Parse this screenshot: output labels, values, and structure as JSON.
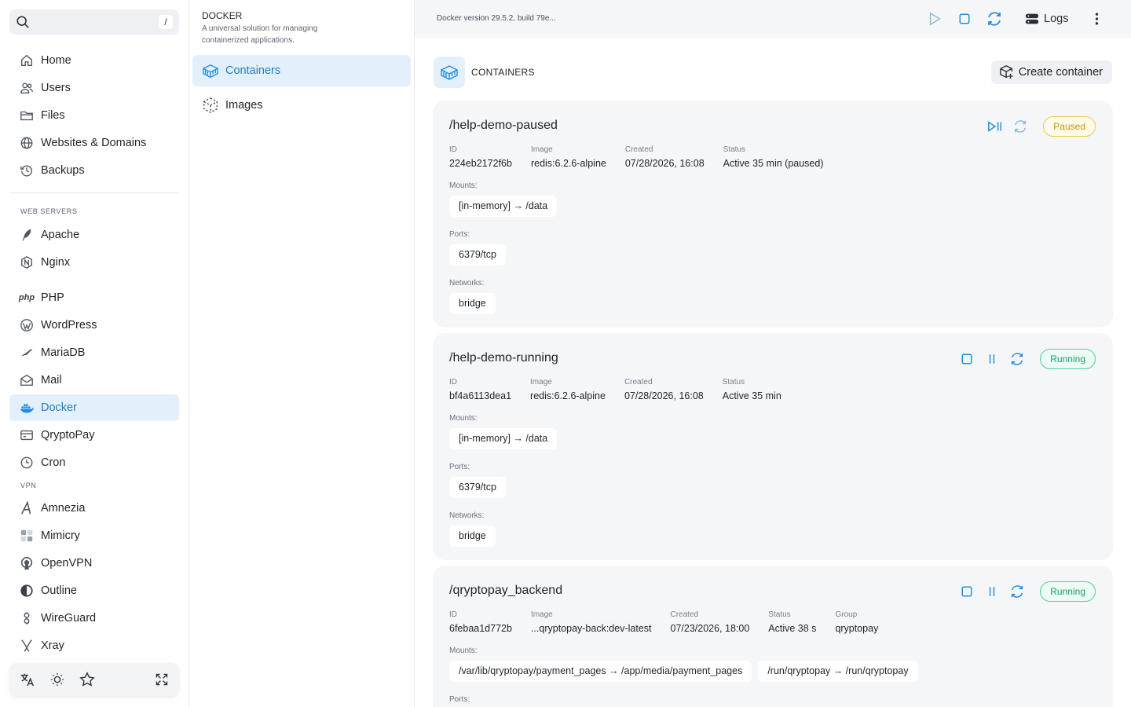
{
  "sidebar": {
    "search_shortcut": "/",
    "items": [
      {
        "label": "Home",
        "icon": "home-icon"
      },
      {
        "label": "Users",
        "icon": "users-icon"
      },
      {
        "label": "Files",
        "icon": "folder-icon"
      },
      {
        "label": "Websites & Domains",
        "icon": "globe-icon"
      },
      {
        "label": "Backups",
        "icon": "history-icon"
      }
    ],
    "section_web_servers": "WEB SERVERS",
    "web_servers": [
      {
        "label": "Apache",
        "icon": "feather-icon"
      },
      {
        "label": "Nginx",
        "icon": "nginx-icon"
      },
      {
        "label": "PHP",
        "icon": "php-icon"
      },
      {
        "label": "WordPress",
        "icon": "wordpress-icon"
      },
      {
        "label": "MariaDB",
        "icon": "mariadb-icon"
      },
      {
        "label": "Mail",
        "icon": "mail-icon"
      },
      {
        "label": "Docker",
        "icon": "docker-icon"
      },
      {
        "label": "QryptoPay",
        "icon": "card-icon"
      },
      {
        "label": "Cron",
        "icon": "clock-icon"
      }
    ],
    "php_glyph": "php",
    "section_vpn": "VPN",
    "vpn": [
      {
        "label": "Amnezia",
        "icon": "amnezia-icon"
      },
      {
        "label": "Mimicry",
        "icon": "mimicry-icon"
      },
      {
        "label": "OpenVPN",
        "icon": "openvpn-icon"
      },
      {
        "label": "Outline",
        "icon": "outline-icon"
      },
      {
        "label": "WireGuard",
        "icon": "wireguard-icon"
      },
      {
        "label": "Xray",
        "icon": "xray-icon"
      }
    ]
  },
  "midpanel": {
    "title": "DOCKER",
    "description": "A universal solution for managing containerized applications.",
    "items": [
      {
        "label": "Containers"
      },
      {
        "label": "Images"
      }
    ]
  },
  "topbar": {
    "version": "Docker version 29.5.2, build 79e...",
    "logs_label": "Logs"
  },
  "section": {
    "title": "CONTAINERS",
    "create_label": "Create container"
  },
  "labels": {
    "id": "ID",
    "image": "Image",
    "created": "Created",
    "status": "Status",
    "group": "Group",
    "mounts": "Mounts:",
    "ports": "Ports:",
    "networks": "Networks:"
  },
  "containers": [
    {
      "name": "/help-demo-paused",
      "badge": "Paused",
      "id": "224eb2172f6b",
      "image": "redis:6.2.6-alpine",
      "created": "07/28/2026, 16:08",
      "status": "Active 35 min (paused)",
      "mounts": [
        "[in-memory] → /data"
      ],
      "ports": [
        "6379/tcp"
      ],
      "networks": [
        "bridge"
      ]
    },
    {
      "name": "/help-demo-running",
      "badge": "Running",
      "id": "bf4a6113dea1",
      "image": "redis:6.2.6-alpine",
      "created": "07/28/2026, 16:08",
      "status": "Active 35 min",
      "mounts": [
        "[in-memory] → /data"
      ],
      "ports": [
        "6379/tcp"
      ],
      "networks": [
        "bridge"
      ]
    },
    {
      "name": "/qryptopay_backend",
      "badge": "Running",
      "id": "6febaa1d772b",
      "image": "...qryptopay-back:dev-latest",
      "created": "07/23/2026, 18:00",
      "status": "Active 38 s",
      "group": "qryptopay",
      "mounts": [
        "/var/lib/qryptopay/payment_pages → /app/media/payment_pages",
        "/run/qryptopay → /run/qryptopay"
      ]
    }
  ],
  "colors": {
    "accent": "#1f8ce0",
    "active_bg": "#e3effb",
    "paused": "#c99400",
    "running": "#1a9e6e"
  }
}
